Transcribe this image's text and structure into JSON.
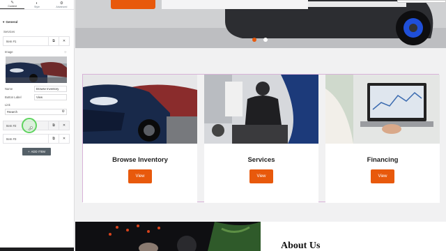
{
  "editor": {
    "tabs": [
      {
        "label": "Content",
        "icon": "pencil-icon"
      },
      {
        "label": "Style",
        "icon": "half-circle-icon"
      },
      {
        "label": "Advanced",
        "icon": "gear-icon"
      }
    ],
    "section_title": "General",
    "services_label": "Services",
    "items": [
      {
        "name": "Item #1"
      },
      {
        "name": "Item #2"
      },
      {
        "name": "Item #3"
      }
    ],
    "image_label": "Image",
    "name_label": "Name",
    "name_value": "Browse Inventory",
    "button_label_label": "Button Label",
    "button_label_value": "View",
    "link_label": "Link",
    "link_value": "#search",
    "add_item_label": "ADD ITEM"
  },
  "preview": {
    "cards": [
      {
        "title": "Browse Inventory",
        "button": "View"
      },
      {
        "title": "Services",
        "button": "View"
      },
      {
        "title": "Financing",
        "button": "View"
      }
    ],
    "about_title": "About Us",
    "accent_color": "#e8590c"
  }
}
